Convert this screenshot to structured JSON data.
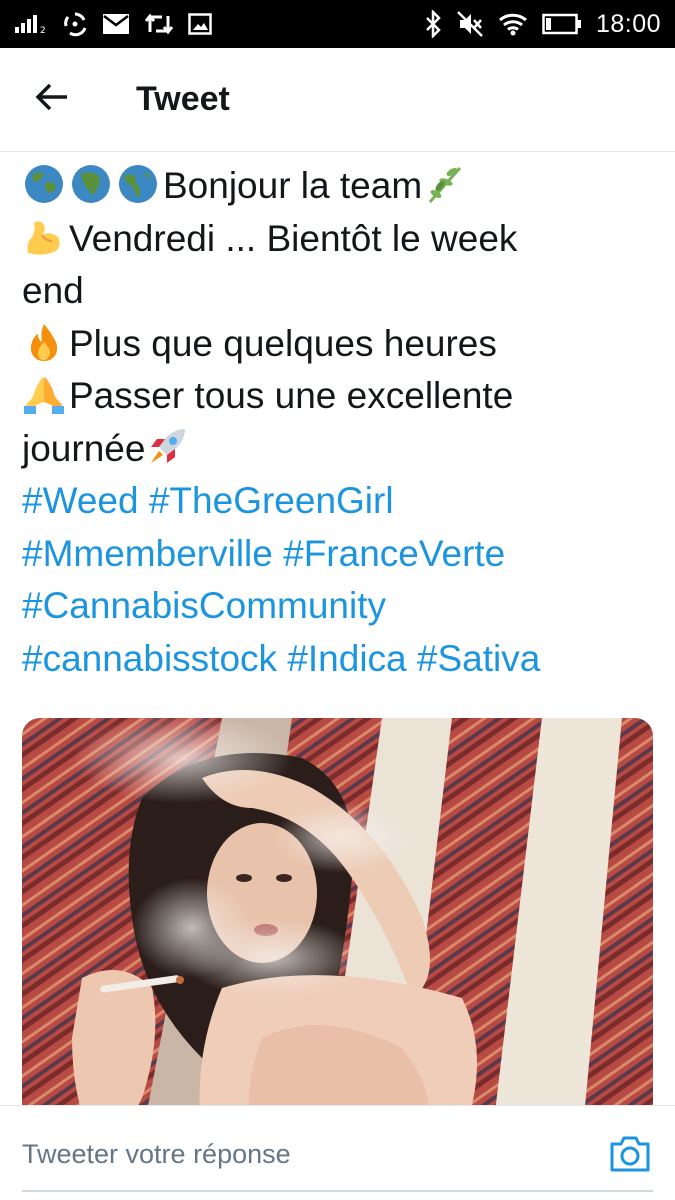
{
  "status_bar": {
    "time": "18:00",
    "left_icons": [
      "signal-icon",
      "sync-icon",
      "mail-icon",
      "retweet-icon",
      "image-icon"
    ],
    "right_icons": [
      "bluetooth-icon",
      "mute-icon",
      "wifi-icon",
      "battery-icon"
    ]
  },
  "header": {
    "back_icon": "arrow-left-icon",
    "title": "Tweet"
  },
  "tweet": {
    "line1_text": "Bonjour la team",
    "line2_text": "Vendredi ... Bientôt le week",
    "line3_text": "end",
    "line4_text": "Plus que quelques heures",
    "line5_text": "Passer tous une excellente",
    "line6_text": "journée",
    "hashtags": {
      "weed": "#Weed",
      "thegreengirl": "#TheGreenGirl",
      "mmemberville": "#Mmemberville",
      "franceverte": "#FranceVerte",
      "cannabiscommunity": "#CannabisCommunity",
      "cannabisstock": "#cannabisstock",
      "indica": "#Indica",
      "sativa": "#Sativa"
    },
    "emojis": [
      "globe-europe-icon",
      "globe-africa-icon",
      "globe-americas-icon",
      "herb-icon",
      "flexed-biceps-icon",
      "fire-icon",
      "folded-hands-icon",
      "rocket-icon"
    ],
    "link_color": "#1b95e0"
  },
  "media": {
    "kind": "photo"
  },
  "reply": {
    "placeholder": "Tweeter votre réponse",
    "camera_icon": "camera-icon",
    "accent": "#1b95e0"
  }
}
